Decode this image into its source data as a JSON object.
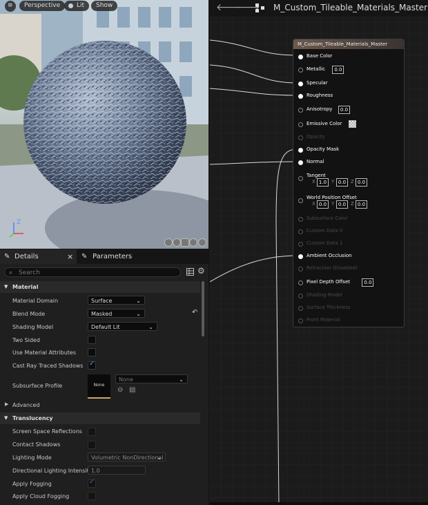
{
  "viewport": {
    "menu_icon": "hamburger-icon",
    "perspective_label": "Perspective",
    "lit_label": "Lit",
    "show_label": "Show",
    "axis_z": "Z"
  },
  "graph": {
    "title": "M_Custom_Tileable_Materials_Master",
    "back_icon": "arrow-left-icon",
    "forward_icon": "arrow-right-icon",
    "node_title": "M_Custom_Tileable_Materials_Master",
    "pins": [
      {
        "label": "Base Color",
        "state": "on"
      },
      {
        "label": "Metallic",
        "state": "off",
        "value": "0.0"
      },
      {
        "label": "Specular",
        "state": "on"
      },
      {
        "label": "Roughness",
        "state": "on"
      },
      {
        "label": "Anisotropy",
        "state": "off",
        "value": "0.0"
      },
      {
        "label": "Emissive Color",
        "state": "off"
      },
      {
        "label": "Opacity",
        "state": "dim"
      },
      {
        "label": "Opacity Mask",
        "state": "on"
      },
      {
        "label": "Normal",
        "state": "on"
      },
      {
        "label": "Tangent",
        "state": "off",
        "x": "1.0",
        "y": "0.0",
        "z": "0.0"
      },
      {
        "label": "World Position Offset",
        "state": "off",
        "x": "0.0",
        "y": "0.0",
        "z": "0.0"
      },
      {
        "label": "Subsurface Color",
        "state": "dim"
      },
      {
        "label": "Custom Data 0",
        "state": "dim"
      },
      {
        "label": "Custom Data 1",
        "state": "dim"
      },
      {
        "label": "Ambient Occlusion",
        "state": "on"
      },
      {
        "label": "Refraction (Disabled)",
        "state": "dim"
      },
      {
        "label": "Pixel Depth Offset",
        "state": "off",
        "value": "0.0"
      },
      {
        "label": "Shading Model",
        "state": "dim"
      },
      {
        "label": "Surface Thickness",
        "state": "dim"
      },
      {
        "label": "Front Material",
        "state": "dim"
      }
    ]
  },
  "details": {
    "tab_details": "Details",
    "tab_parameters": "Parameters",
    "close": "×",
    "search_placeholder": "Search",
    "section_material": "Material",
    "section_advanced": "Advanced",
    "section_translucency": "Translucency",
    "material_domain_label": "Material Domain",
    "material_domain_value": "Surface",
    "blend_mode_label": "Blend Mode",
    "blend_mode_value": "Masked",
    "shading_model_label": "Shading Model",
    "shading_model_value": "Default Lit",
    "two_sided_label": "Two Sided",
    "two_sided": false,
    "use_material_attributes_label": "Use Material Attributes",
    "use_material_attributes": false,
    "cast_ray_traced_shadows_label": "Cast Ray Traced Shadows",
    "cast_ray_traced_shadows": true,
    "subsurface_profile_label": "Subsurface Profile",
    "subsurface_thumb": "None",
    "subsurface_value": "None",
    "ssr_label": "Screen Space Reflections",
    "contact_shadows_label": "Contact Shadows",
    "lighting_mode_label": "Lighting Mode",
    "lighting_mode_value": "Volumetric NonDirectional",
    "dir_light_label": "Directional Lighting Intensity",
    "dir_light_value": "1.0",
    "apply_fogging_label": "Apply Fogging",
    "apply_fogging": true,
    "apply_cloud_fogging_label": "Apply Cloud Fogging",
    "apply_cloud_fogging": false
  },
  "colors": {
    "accent": "#4a9bff",
    "node_header": "#6c5a4e",
    "panel_bg": "#1f1f1f"
  }
}
